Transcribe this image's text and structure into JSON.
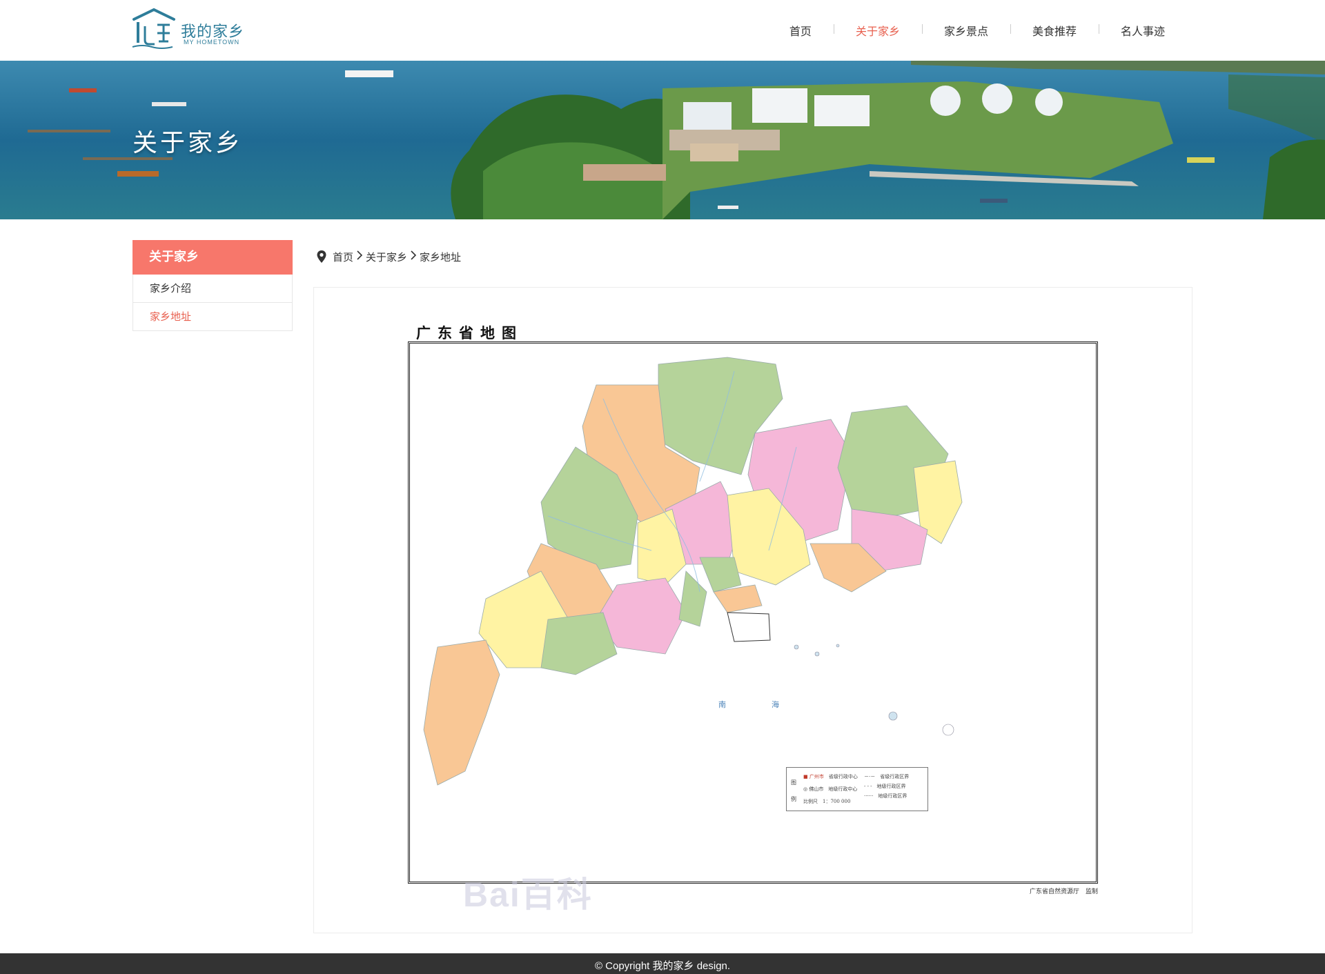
{
  "brand": {
    "name": "我的家乡",
    "subtitle": "MY HOMETOWN",
    "accent": "#e8604f",
    "logo_color": "#2e7d9a"
  },
  "nav": {
    "items": [
      {
        "label": "首页",
        "active": false
      },
      {
        "label": "关于家乡",
        "active": true
      },
      {
        "label": "家乡景点",
        "active": false
      },
      {
        "label": "美食推荐",
        "active": false
      },
      {
        "label": "名人事迹",
        "active": false
      }
    ]
  },
  "banner": {
    "title": "关于家乡"
  },
  "sidebar": {
    "head": "关于家乡",
    "items": [
      {
        "label": "家乡介绍",
        "active": false
      },
      {
        "label": "家乡地址",
        "active": true
      }
    ],
    "head_color": "#f7776b"
  },
  "breadcrumb": {
    "icon": "location-pin-icon",
    "items": [
      "首页",
      "关于家乡",
      "家乡地址"
    ]
  },
  "map": {
    "title": "广东省地图",
    "credit": "广东省自然资源厅　监制",
    "sea_labels": [
      "南",
      "海"
    ],
    "legend": {
      "head": "图例",
      "capital": "广州市",
      "capital_desc": "省级行政中心",
      "city": "佛山市",
      "city_desc": "地级行政中心",
      "boundary_1": "省级行政区界",
      "boundary_2": "地级行政区界",
      "boundary_3": "地级行政区界",
      "scale": "比例尺　1：700 000"
    },
    "watermark": "Bai百科"
  },
  "footer": {
    "text": "©  Copyright  我的家乡  design."
  }
}
